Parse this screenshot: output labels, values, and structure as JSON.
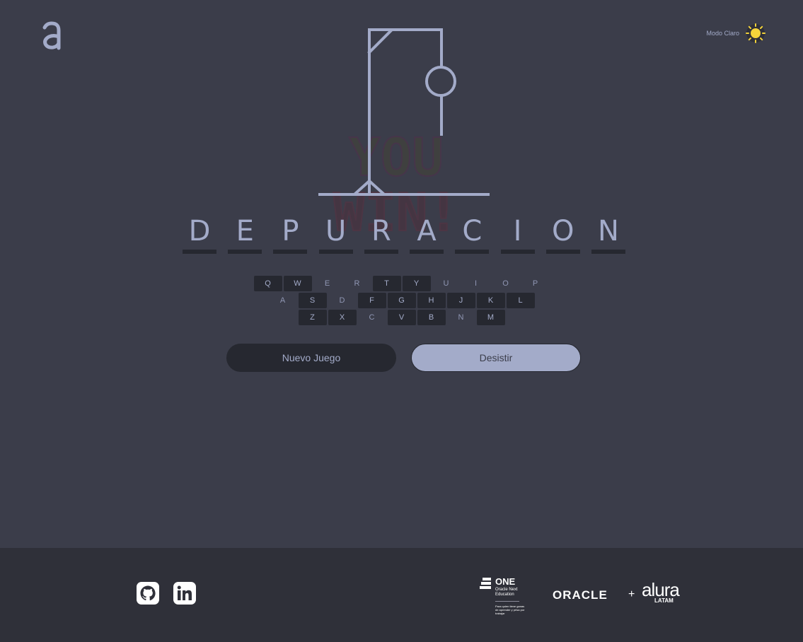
{
  "header": {
    "theme_label": "Modo Claro",
    "theme_icon": "sun-icon",
    "logo_icon": "alura-logo"
  },
  "game": {
    "word": [
      "D",
      "E",
      "P",
      "U",
      "R",
      "A",
      "C",
      "I",
      "O",
      "N"
    ],
    "win_message": "YOU WIN!"
  },
  "keyboard": {
    "rows": [
      [
        {
          "k": "Q",
          "used": false
        },
        {
          "k": "W",
          "used": false
        },
        {
          "k": "E",
          "used": true
        },
        {
          "k": "R",
          "used": true
        },
        {
          "k": "T",
          "used": false
        },
        {
          "k": "Y",
          "used": false
        },
        {
          "k": "U",
          "used": true
        },
        {
          "k": "I",
          "used": true
        },
        {
          "k": "O",
          "used": true
        },
        {
          "k": "P",
          "used": true
        }
      ],
      [
        {
          "k": "A",
          "used": true
        },
        {
          "k": "S",
          "used": false
        },
        {
          "k": "D",
          "used": true
        },
        {
          "k": "F",
          "used": false
        },
        {
          "k": "G",
          "used": false
        },
        {
          "k": "H",
          "used": false
        },
        {
          "k": "J",
          "used": false
        },
        {
          "k": "K",
          "used": false
        },
        {
          "k": "L",
          "used": false
        }
      ],
      [
        {
          "k": "Z",
          "used": false
        },
        {
          "k": "X",
          "used": false
        },
        {
          "k": "C",
          "used": true
        },
        {
          "k": "V",
          "used": false
        },
        {
          "k": "B",
          "used": false
        },
        {
          "k": "N",
          "used": true
        },
        {
          "k": "M",
          "used": false
        }
      ]
    ]
  },
  "buttons": {
    "new_game": "Nuevo Juego",
    "give_up": "Desistir"
  },
  "footer": {
    "social": [
      "github-icon",
      "linkedin-icon"
    ],
    "one_title": "ONE",
    "one_subtitle": "Oracle Next Education",
    "one_tagline": "Para quien tiene ganas de aprender y prisa por trabajar",
    "oracle": "ORACLE",
    "plus": "+",
    "alura": "alura",
    "latam": "LATAM"
  },
  "colors": {
    "background": "#3b3d4a",
    "accent": "#a3abc9",
    "dark": "#262830",
    "footer": "#2f3039",
    "sun": "#f5d43a"
  }
}
